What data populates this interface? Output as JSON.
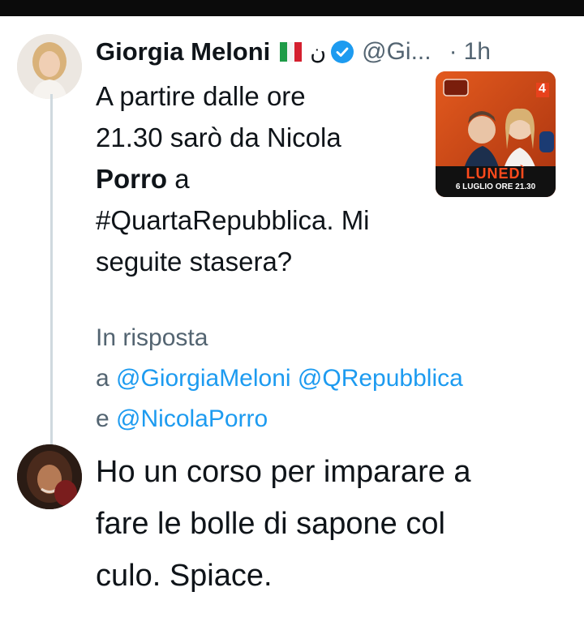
{
  "tweet": {
    "author_name": "Giorgia Meloni",
    "extra_glyph": "ن",
    "handle": "@Gi...",
    "separator": "·",
    "time": "1h",
    "text_lines": [
      "A partire dalle ore",
      "21.30 sarò da Nicola",
      "a",
      "#QuartaRepubblica. Mi",
      "seguite stasera?"
    ],
    "bold_name": "Porro",
    "media": {
      "badge_number": "4",
      "day_label": "LUNEDÌ",
      "date_label": "6 LUGLIO ORE 21.30"
    }
  },
  "reply_context": {
    "prefix": "In risposta",
    "a": "a",
    "mentions": [
      "@GiorgiaMeloni",
      "@QRepubblica",
      "@NicolaPorro"
    ],
    "e": "e"
  },
  "reply": {
    "text_lines": [
      "Ho un corso per imparare a",
      "fare le bolle di sapone col",
      "culo. Spiace."
    ]
  },
  "colors": {
    "text": "#0f1419",
    "secondary": "#536471",
    "link": "#1d9bf0",
    "verified": "#1d9bf0",
    "thread_line": "#cfd9de"
  },
  "icons": {
    "verified": "verified-badge-icon",
    "flag": "italy-flag-icon"
  }
}
